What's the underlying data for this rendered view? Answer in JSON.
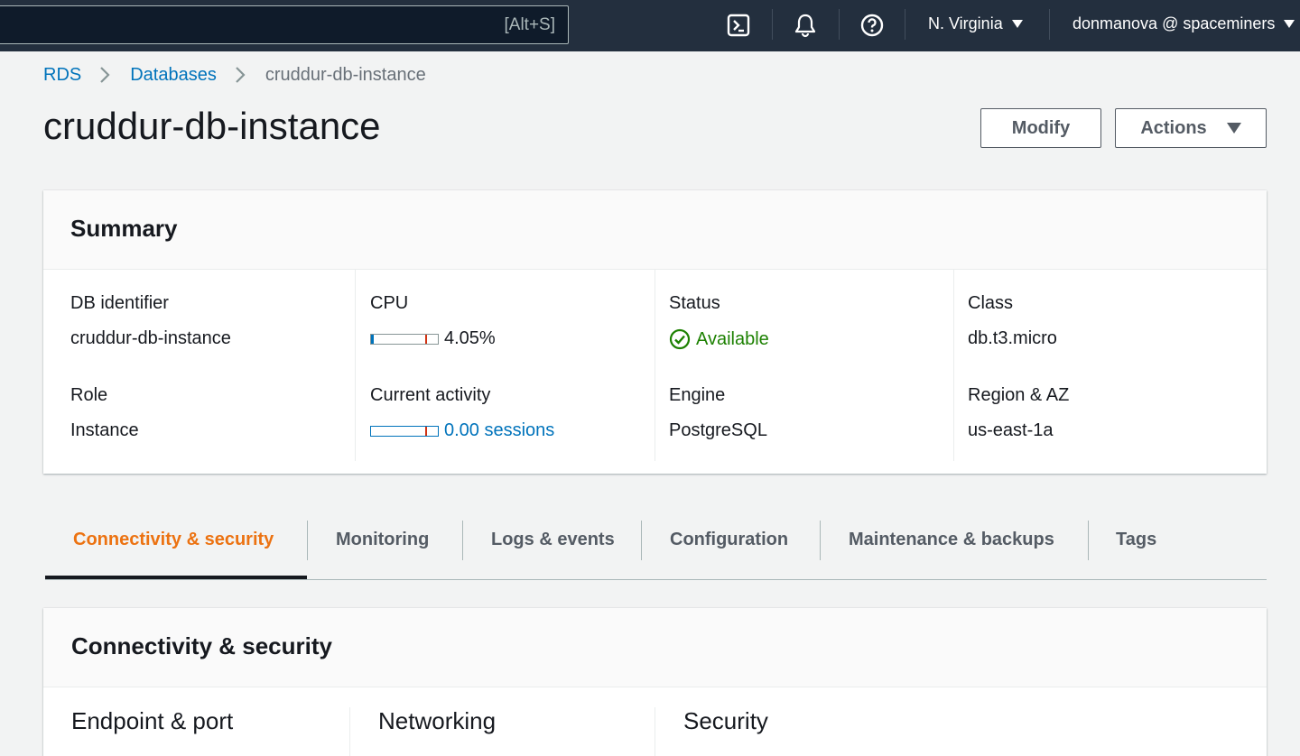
{
  "topnav": {
    "search_hint": "[Alt+S]",
    "region": "N. Virginia",
    "account": "donmanova @ spaceminers",
    "icons": [
      "cloudshell-icon",
      "bell-icon",
      "help-icon"
    ]
  },
  "breadcrumb": {
    "items": [
      "RDS",
      "Databases"
    ],
    "current": "cruddur-db-instance"
  },
  "page": {
    "title": "cruddur-db-instance",
    "modify_label": "Modify",
    "actions_label": "Actions"
  },
  "summary": {
    "title": "Summary",
    "db_identifier_label": "DB identifier",
    "db_identifier": "cruddur-db-instance",
    "role_label": "Role",
    "role": "Instance",
    "cpu_label": "CPU",
    "cpu": "4.05%",
    "cpu_fraction": 0.0405,
    "activity_label": "Current activity",
    "activity": "0.00 sessions",
    "activity_fraction": 0.0,
    "status_label": "Status",
    "status": "Available",
    "engine_label": "Engine",
    "engine": "PostgreSQL",
    "class_label": "Class",
    "class": "db.t3.micro",
    "region_az_label": "Region & AZ",
    "region_az": "us-east-1a"
  },
  "tabs": [
    "Connectivity & security",
    "Monitoring",
    "Logs & events",
    "Configuration",
    "Maintenance & backups",
    "Tags"
  ],
  "connectivity": {
    "title": "Connectivity & security",
    "sections": [
      "Endpoint & port",
      "Networking",
      "Security"
    ]
  },
  "colors": {
    "nav_bg": "#232f3e",
    "link": "#0073bb",
    "active_tab": "#ec7211",
    "status_ok": "#1d8102"
  }
}
